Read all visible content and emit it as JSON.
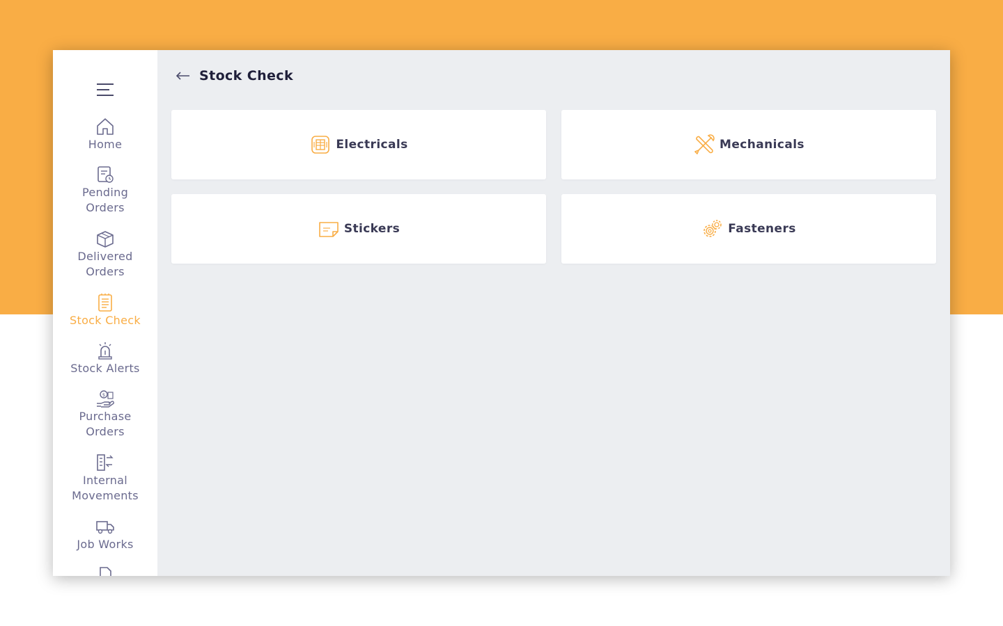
{
  "colors": {
    "accent": "#f9ad45",
    "nav_text": "#6a6a8e",
    "title": "#1f1f3a"
  },
  "header": {
    "title": "Stock Check"
  },
  "sidebar": {
    "items": [
      {
        "label": "Home",
        "icon": "home-icon",
        "active": false
      },
      {
        "label": "Pending\nOrders",
        "icon": "pending-orders-icon",
        "active": false
      },
      {
        "label": "Delivered\nOrders",
        "icon": "box-icon",
        "active": false
      },
      {
        "label": "Stock Check",
        "icon": "clipboard-list-icon",
        "active": true
      },
      {
        "label": "Stock Alerts",
        "icon": "alarm-icon",
        "active": false
      },
      {
        "label": "Purchase\nOrders",
        "icon": "purchase-hand-icon",
        "active": false
      },
      {
        "label": "Internal\nMovements",
        "icon": "transfer-icon",
        "active": false
      },
      {
        "label": "Job Works",
        "icon": "truck-icon",
        "active": false
      }
    ]
  },
  "categories": [
    {
      "label": "Electricals",
      "icon": "electricals-icon"
    },
    {
      "label": "Mechanicals",
      "icon": "wrench-screwdriver-icon"
    },
    {
      "label": "Stickers",
      "icon": "sticker-icon"
    },
    {
      "label": "Fasteners",
      "icon": "gears-icon"
    }
  ]
}
